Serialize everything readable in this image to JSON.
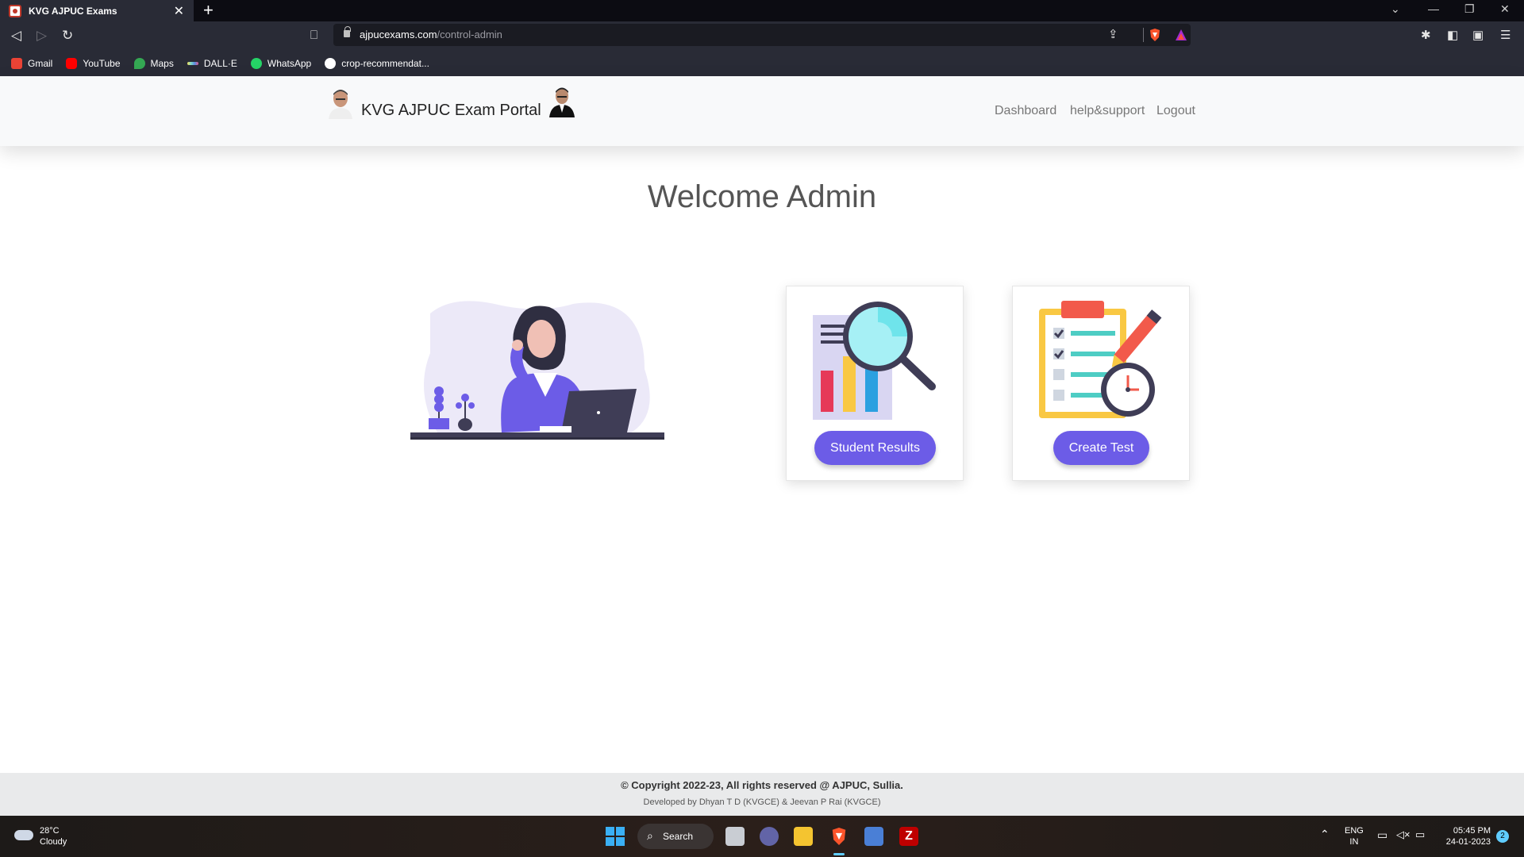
{
  "browser": {
    "tab_title": "KVG AJPUC Exams",
    "tab_close": "✕",
    "new_tab": "+",
    "url_host": "ajpucexams.com",
    "url_path": "/control-admin",
    "bookmarks": [
      {
        "label": "Gmail",
        "icon": "gmail-icon",
        "color": "#ea4335"
      },
      {
        "label": "YouTube",
        "icon": "youtube-icon",
        "color": "#ff0000"
      },
      {
        "label": "Maps",
        "icon": "maps-icon",
        "color": "#34a853"
      },
      {
        "label": "DALL·E",
        "icon": "dalle-icon",
        "color": "#7fd8c8"
      },
      {
        "label": "WhatsApp",
        "icon": "whatsapp-icon",
        "color": "#25d366"
      },
      {
        "label": "crop-recommendat...",
        "icon": "github-icon",
        "color": "#ffffff"
      }
    ]
  },
  "header": {
    "brand": "KVG AJPUC Exam Portal",
    "nav": [
      "Dashboard",
      "help&support",
      "Logout"
    ]
  },
  "main": {
    "welcome": "Welcome Admin",
    "cards": [
      {
        "label": "Student Results",
        "icon": "results-magnifier-icon"
      },
      {
        "label": "Create Test",
        "icon": "clipboard-test-icon"
      }
    ]
  },
  "footer": {
    "copyright": "© Copyright 2022-23, All rights reserved @ AJPUC, Sullia.",
    "developed": "Developed by Dhyan T D (KVGCE) & Jeevan P Rai (KVGCE)"
  },
  "taskbar": {
    "temperature": "28°C",
    "weather": "Cloudy",
    "search": "Search",
    "lang_1": "ENG",
    "lang_2": "IN",
    "time": "05:45 PM",
    "date": "24-01-2023",
    "notifications": "2"
  },
  "colors": {
    "accent": "#6c5ce7",
    "chrome": "#292b36"
  }
}
